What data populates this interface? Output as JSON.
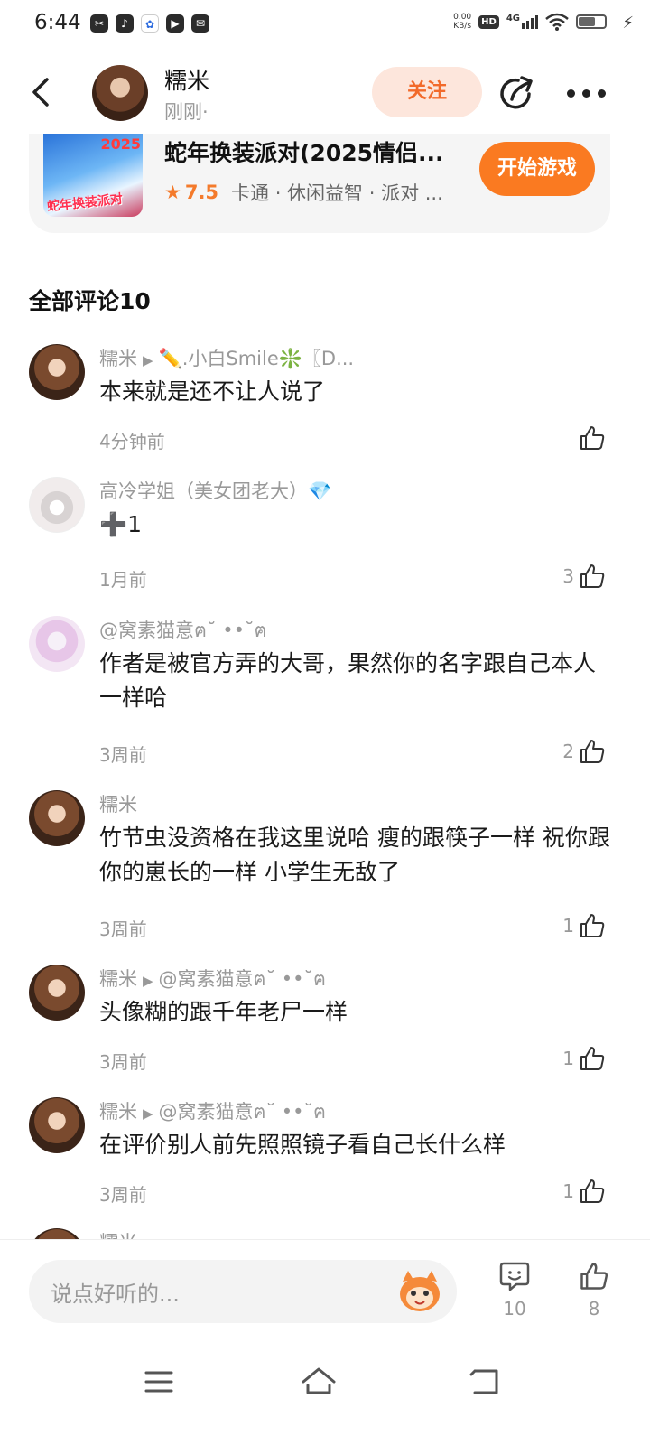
{
  "status_bar": {
    "time": "6:44",
    "net_speed_value": "0.00",
    "net_speed_unit": "KB/s",
    "hd": "HD",
    "signal": "4G"
  },
  "header": {
    "author_name": "糯米",
    "author_time": "刚刚·",
    "follow_label": "关注"
  },
  "game": {
    "thumb_text": "蛇年换装派对",
    "thumb_year": "2025",
    "title": "蛇年换装派对(2025情侣...",
    "rating": "7.5",
    "tags": "卡通 · 休闲益智 · 派对 ...",
    "play_label": "开始游戏"
  },
  "comments_header": "全部评论10",
  "comments": [
    {
      "user": "糯米",
      "reply_to": "✏️.小白Smile❇️〖D...",
      "text": "本来就是还不让人说了",
      "time": "4分钟前",
      "likes": ""
    },
    {
      "user": "高冷学姐（美女团老大）💎",
      "reply_to": "",
      "text": "➕1",
      "time": "1月前",
      "likes": "3"
    },
    {
      "user": "@窝素猫意ฅ˘ ••˘ฅ",
      "reply_to": "",
      "text": "作者是被官方弄的大哥，果然你的名字跟自己本人一样哈",
      "time": "3周前",
      "likes": "2"
    },
    {
      "user": "糯米",
      "reply_to": "",
      "text": "竹节虫没资格在我这里说哈 瘦的跟筷子一样 祝你跟你的崽长的一样 小学生无敌了",
      "time": "3周前",
      "likes": "1"
    },
    {
      "user": "糯米",
      "reply_to": "@窝素猫意ฅ˘ ••˘ฅ",
      "text": "头像糊的跟千年老尸一样",
      "time": "3周前",
      "likes": "1"
    },
    {
      "user": "糯米",
      "reply_to": "@窝素猫意ฅ˘ ••˘ฅ",
      "text": "在评价别人前先照照镜子看自己长什么样",
      "time": "3周前",
      "likes": "1"
    }
  ],
  "partial_comment_user": "糯米",
  "bottom_bar": {
    "input_placeholder": "说点好听的...",
    "comment_count": "10",
    "like_count": "8"
  }
}
